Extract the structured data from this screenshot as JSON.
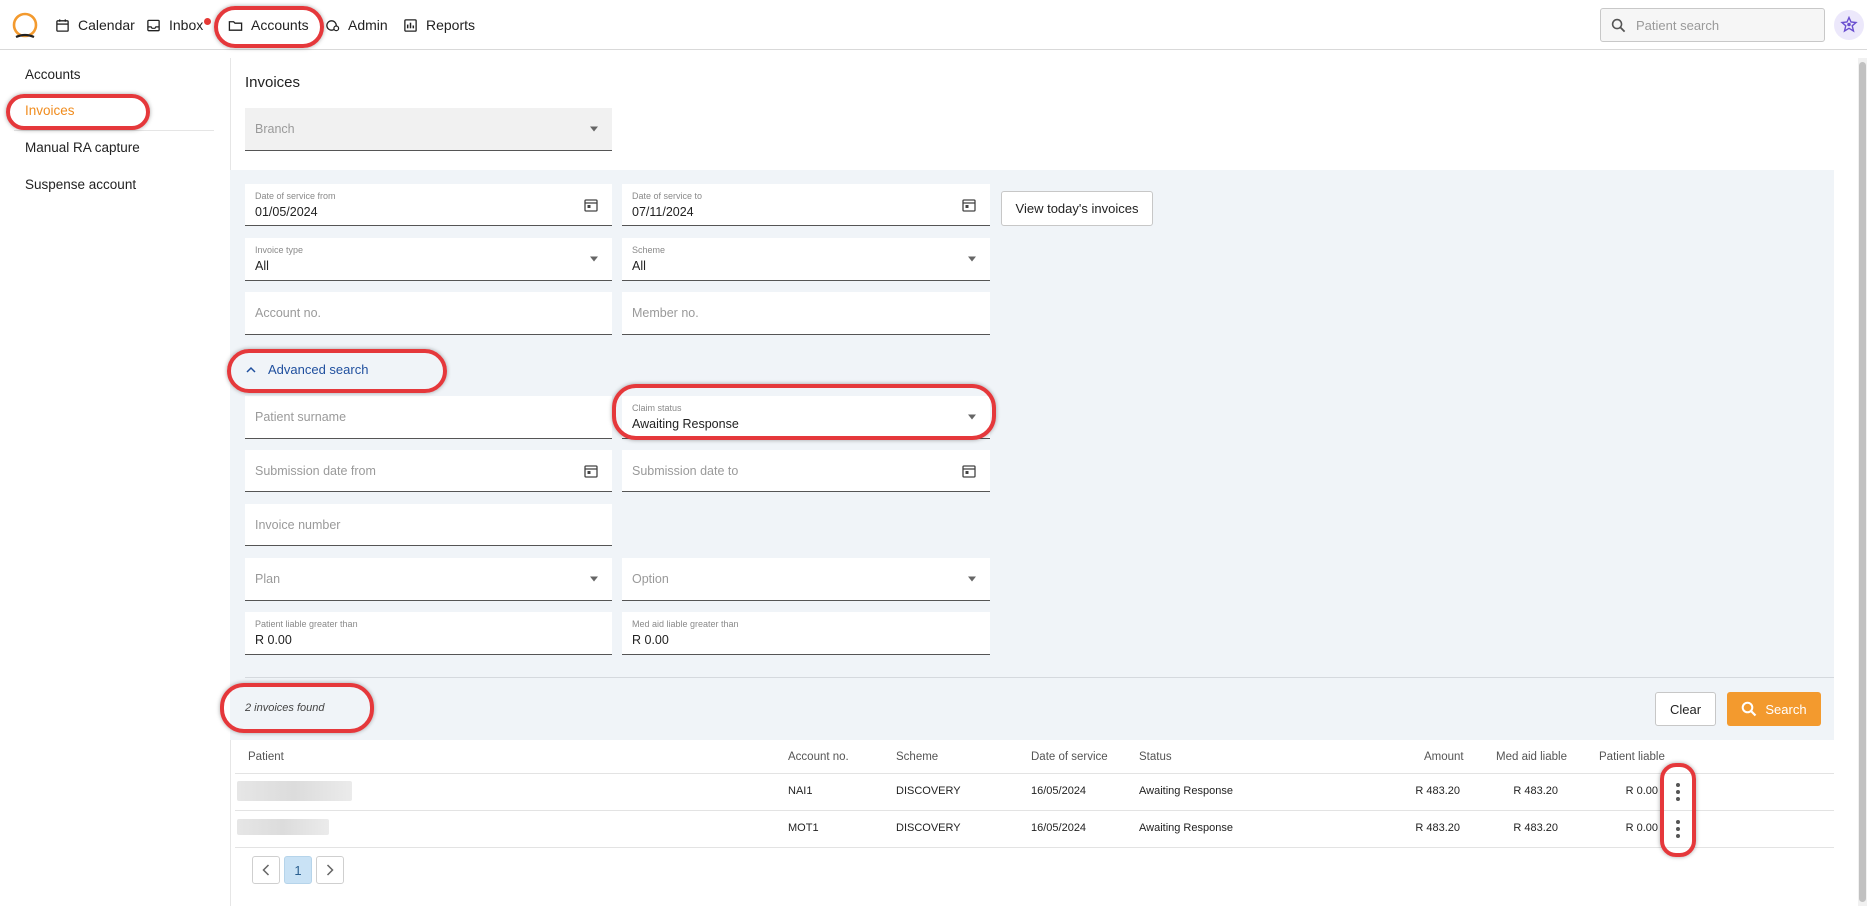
{
  "topnav": {
    "items": [
      {
        "label": "Calendar",
        "icon": "calendar-icon"
      },
      {
        "label": "Inbox",
        "icon": "inbox-icon"
      },
      {
        "label": "Accounts",
        "icon": "folder-icon"
      },
      {
        "label": "Admin",
        "icon": "admin-icon"
      },
      {
        "label": "Reports",
        "icon": "reports-icon"
      }
    ],
    "search_placeholder": "Patient search",
    "inbox_dot_color": "#e53935"
  },
  "sidebar": {
    "items": [
      {
        "label": "Accounts",
        "active": false
      },
      {
        "label": "Invoices",
        "active": true
      },
      {
        "label": "Manual RA capture",
        "active": false
      },
      {
        "label": "Suspense account",
        "active": false
      }
    ],
    "active_color": "#f08c1e"
  },
  "page": {
    "title": "Invoices",
    "branch_placeholder": "Branch"
  },
  "filters": {
    "date_from_label": "Date of service from",
    "date_from_value": "01/05/2024",
    "date_to_label": "Date of service to",
    "date_to_value": "07/11/2024",
    "view_today_button": "View today's invoices",
    "invoice_type_label": "Invoice type",
    "invoice_type_value": "All",
    "scheme_label": "Scheme",
    "scheme_value": "All",
    "account_no_placeholder": "Account no.",
    "member_no_placeholder": "Member no.",
    "advanced_search_label": "Advanced search",
    "patient_surname_placeholder": "Patient surname",
    "claim_status_label": "Claim status",
    "claim_status_value": "Awaiting Response",
    "submission_from_placeholder": "Submission date from",
    "submission_to_placeholder": "Submission date to",
    "invoice_number_placeholder": "Invoice number",
    "plan_placeholder": "Plan",
    "option_placeholder": "Option",
    "patient_liable_label": "Patient liable greater than",
    "patient_liable_value": "R 0.00",
    "medaid_liable_label": "Med aid liable greater than",
    "medaid_liable_value": "R 0.00"
  },
  "results": {
    "count_text": "2 invoices found",
    "clear_button": "Clear",
    "search_button": "Search",
    "accent_color": "#f39a2e"
  },
  "table": {
    "headers": [
      "Patient",
      "Account no.",
      "Scheme",
      "Date of service",
      "Status",
      "Amount",
      "Med aid liable",
      "Patient liable"
    ],
    "rows": [
      {
        "account_no": "NAI1",
        "scheme": "DISCOVERY",
        "date": "16/05/2024",
        "status": "Awaiting Response",
        "amount": "R 483.20",
        "medaid": "R 483.20",
        "patient_liable": "R 0.00"
      },
      {
        "account_no": "MOT1",
        "scheme": "DISCOVERY",
        "date": "16/05/2024",
        "status": "Awaiting Response",
        "amount": "R 483.20",
        "medaid": "R 483.20",
        "patient_liable": "R 0.00"
      }
    ]
  },
  "pagination": {
    "current_page": "1"
  }
}
